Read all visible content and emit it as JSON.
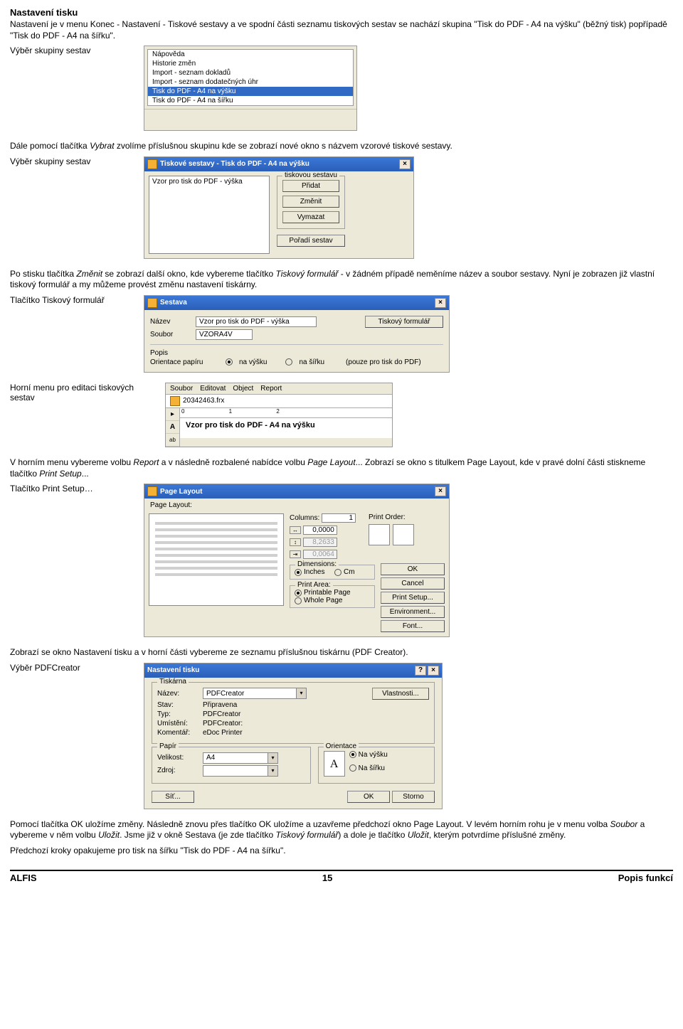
{
  "heading": "Nastavení tisku",
  "p_intro": "Nastavení je v menu Konec - Nastavení - Tiskové sestavy a ve spodní části seznamu tiskových sestav se nachází skupina \"Tisk do PDF - A4 na výšku\" (běžný tisk) popřípadě  \"Tisk do PDF - A4 na šířku\".",
  "cap_shot1": "Výběr skupiny sestav",
  "shot1_items": [
    "Nápověda",
    "Historie změn",
    "Import - seznam dokladů",
    "Import - seznam dodatečných úhr",
    "Tisk do PDF - A4 na výšku",
    "Tisk do PDF - A4 na šířku"
  ],
  "shot1_selected_index": 4,
  "p_after1a": "Dále pomocí tlačítka ",
  "p_after1b": "Vybrat",
  "p_after1c": " zvolíme příslušnou skupinu kde se zobrazí nové okno s názvem vzorové tiskové sestavy.",
  "cap_shot2": "Výběr skupiny sestav",
  "shot2": {
    "title": "Tiskové sestavy - Tisk do PDF - A4 na výšku",
    "list_item": "Vzor pro tisk do PDF - výška",
    "fs_label": "tiskovou sestavu",
    "btn_pridat": "Přidat",
    "btn_zmenit": "Změnit",
    "btn_vymazat": "Vymazat",
    "btn_poradi": "Pořadí sestav"
  },
  "p_after2a": "Po stisku tlačítka  ",
  "p_after2b": "Změnit",
  "p_after2c": " se zobrazí další okno, kde vybereme tlačítko ",
  "p_after2d": "Tiskový formulář",
  "p_after2e": " - v žádném případě neměníme název a soubor sestavy. Nyní je zobrazen již vlastní tiskový formulář a my můžeme provést změnu nastavení tiskárny.",
  "cap_shot3": "Tlačítko Tiskový formulář",
  "shot3": {
    "title": "Sestava",
    "lbl_nazev": "Název",
    "val_nazev": "Vzor pro tisk do PDF - výška",
    "lbl_soubor": "Soubor",
    "val_soubor": "VZORA4V",
    "btn_form": "Tiskový formulář",
    "lbl_popis": "Popis",
    "lbl_orient": "Orientace papíru",
    "opt_vysku": "na výšku",
    "opt_sirku": "na šířku",
    "note": "(pouze pro tisk do PDF)"
  },
  "cap_shot4": "Horní menu pro editaci tiskových sestav",
  "shot4": {
    "menu": [
      "Soubor",
      "Editovat",
      "Object",
      "Report"
    ],
    "file": "20342463.frx",
    "ruler_marks": "0            1            2",
    "canvas_text": "Vzor pro tisk do PDF - A4 na výšku"
  },
  "p_after4a": "V horním menu vybereme volbu ",
  "p_after4b": "Report",
  "p_after4c": " a v následně rozbalené nabídce volbu ",
  "p_after4d": "Page Layout",
  "p_after4e": "... Zobrazí se okno s titulkem Page Layout, kde v pravé dolní části stiskneme tlačítko ",
  "p_after4f": "Print Setup",
  "p_after4g": "...",
  "cap_shot5": "Tlačítko Print Setup…",
  "shot5": {
    "title": "Page Layout",
    "lbl_pl": "Page Layout:",
    "lbl_columns": "Columns:",
    "val_columns": "1",
    "val_w": "0,0000",
    "val_h": "8,2633",
    "val_m": "0,0064",
    "lbl_po": "Print Order:",
    "fs_dim": "Dimensions:",
    "opt_in": "Inches",
    "opt_cm": "Cm",
    "fs_area": "Print Area:",
    "opt_pp": "Printable Page",
    "opt_wp": "Whole Page",
    "btn_ok": "OK",
    "btn_cancel": "Cancel",
    "btn_ps": "Print Setup...",
    "btn_env": "Environment...",
    "btn_font": "Font..."
  },
  "p_after5": "Zobrazí se okno Nastavení tisku a v horní části vybereme ze seznamu příslušnou tiskárnu (PDF Creator).",
  "cap_shot6": "Výběr PDFCreator",
  "shot6": {
    "title": "Nastavení tisku",
    "fs_tisk": "Tiskárna",
    "lbl_nazev": "Název:",
    "val_nazev": "PDFCreator",
    "btn_vlast": "Vlastnosti...",
    "lbl_stav": "Stav:",
    "val_stav": "Připravena",
    "lbl_typ": "Typ:",
    "val_typ": "PDFCreator",
    "lbl_umist": "Umístění:",
    "val_umist": "PDFCreator:",
    "lbl_kom": "Komentář:",
    "val_kom": "eDoc Printer",
    "fs_papir": "Papír",
    "lbl_vel": "Velikost:",
    "val_vel": "A4",
    "lbl_zdroj": "Zdroj:",
    "fs_orient": "Orientace",
    "opt_vysku": "Na výšku",
    "opt_sirku": "Na šířku",
    "btn_sit": "Síť...",
    "btn_ok": "OK",
    "btn_storno": "Storno"
  },
  "p_final1": "Pomocí tlačítka OK uložíme změny. Následně znovu přes tlačítko OK uložíme a uzavřeme předchozí okno Page Layout. V levém horním rohu je v menu volba ",
  "p_final1b": "Soubor",
  "p_final1c": " a vybereme v něm volbu ",
  "p_final1d": "Uložit",
  "p_final1e": ". Jsme již v okně Sestava (je zde tlačítko ",
  "p_final1f": "Tiskový formulář",
  "p_final1g": ") a dole je tlačítko ",
  "p_final1h": "Uložit",
  "p_final1i": ", kterým potvrdíme příslušné změny.",
  "p_final2": "Předchozí kroky opakujeme pro tisk na šířku \"Tisk do PDF - A4 na šířku\".",
  "footer_left": "ALFIS",
  "footer_center": "15",
  "footer_right": "Popis funkcí"
}
